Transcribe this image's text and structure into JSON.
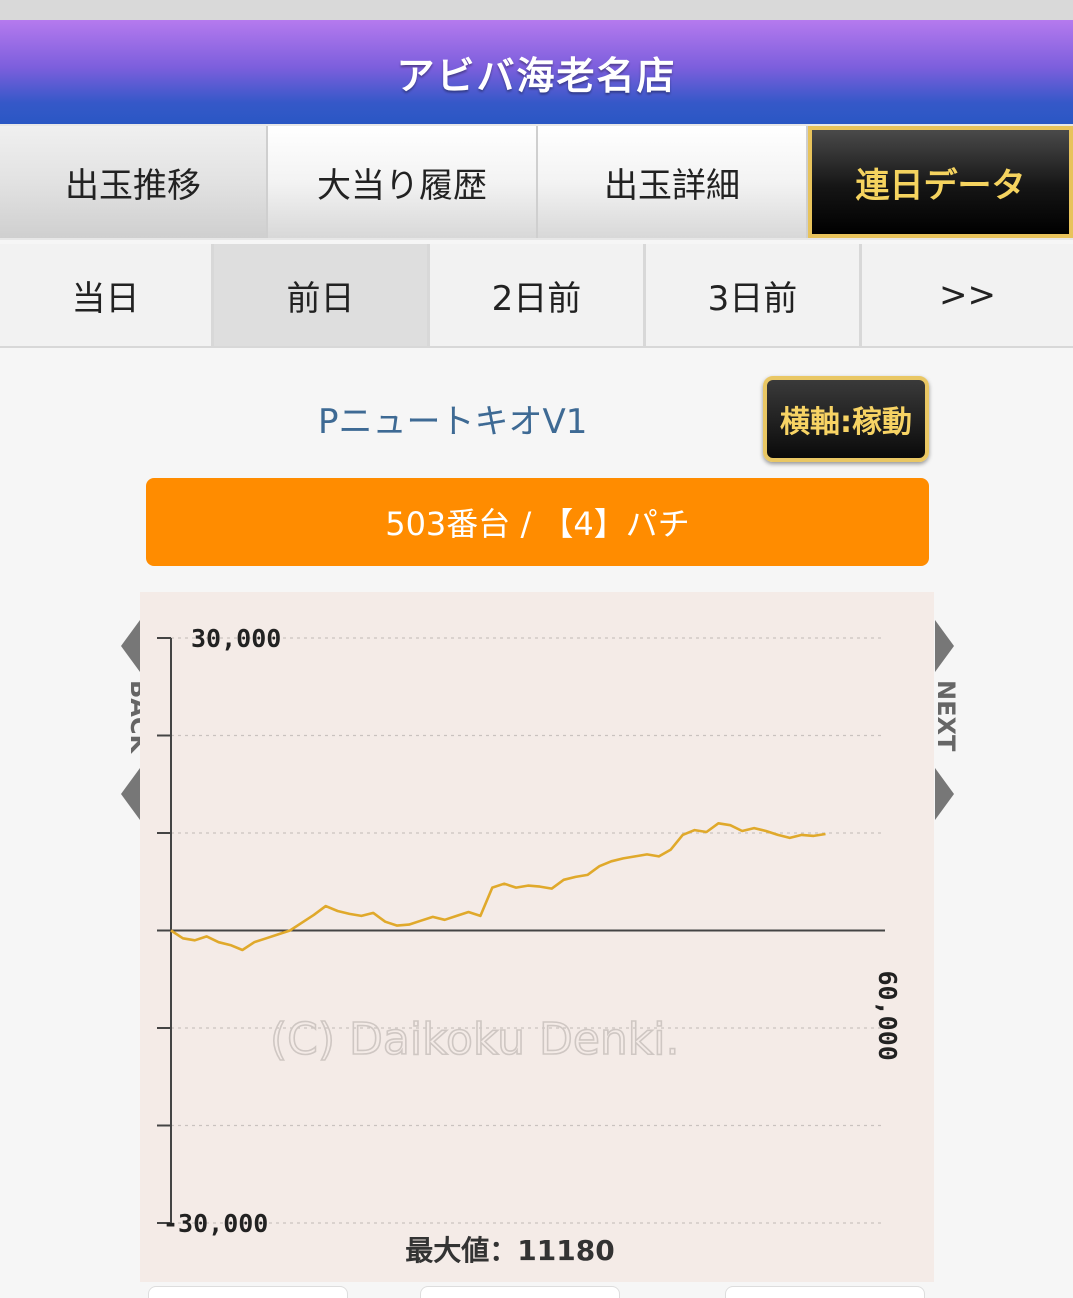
{
  "header": {
    "title": "アビバ海老名店"
  },
  "main_tabs": [
    {
      "label": "出玉推移",
      "state": "dim"
    },
    {
      "label": "大当り履歴",
      "state": "normal"
    },
    {
      "label": "出玉詳細",
      "state": "normal"
    },
    {
      "label": "連日データ",
      "state": "active"
    }
  ],
  "day_tabs": [
    {
      "label": "当日"
    },
    {
      "label": "前日",
      "selected": true
    },
    {
      "label": "2日前"
    },
    {
      "label": "3日前"
    },
    {
      "label": ">>"
    }
  ],
  "machine": {
    "name": "PニュートキオV1",
    "axis_button": "横軸:稼動",
    "unit_label": "503番台 / 【4】パチ"
  },
  "nav": {
    "back": "BACK",
    "next": "NEXT"
  },
  "chart_data": {
    "type": "line",
    "y_top_label": "30,000",
    "y_bottom_label": "-30,000",
    "x_end_label": "60,000",
    "ylim": [
      -30000,
      30000
    ],
    "xlim": [
      0,
      60000
    ],
    "watermark": "(C) Daikoku Denki.",
    "footer": "最大値：11180",
    "grid": true,
    "line_color": "#e0a92b",
    "series": [
      {
        "x": [
          0,
          1000,
          2000,
          3000,
          4000,
          5000,
          6000,
          7000,
          8000,
          9000,
          10000,
          11000,
          12000,
          13000,
          14000,
          15000,
          16000,
          17000,
          18000,
          19000,
          20000,
          21000,
          22000,
          23000,
          24000,
          25000,
          26000,
          27000,
          28000,
          29000,
          30000,
          31000,
          32000,
          33000,
          34000,
          35000,
          36000,
          37000,
          38000,
          39000,
          40000,
          41000,
          42000,
          43000,
          44000,
          45000,
          46000,
          47000,
          48000,
          49000,
          50000,
          51000,
          52000,
          53000,
          54000,
          55000
        ],
        "y": [
          0,
          -800,
          -1000,
          -600,
          -1200,
          -1500,
          -2000,
          -1200,
          -800,
          -400,
          0,
          800,
          1600,
          2500,
          2000,
          1700,
          1500,
          1800,
          900,
          500,
          600,
          1000,
          1400,
          1100,
          1500,
          1900,
          1500,
          4400,
          4800,
          4400,
          4600,
          4500,
          4300,
          5200,
          5500,
          5700,
          6600,
          7100,
          7400,
          7600,
          7800,
          7600,
          8300,
          9800,
          10300,
          10100,
          11000,
          10800,
          10200,
          10500,
          10200,
          9800,
          9500,
          9800,
          9700,
          9900
        ]
      }
    ]
  }
}
